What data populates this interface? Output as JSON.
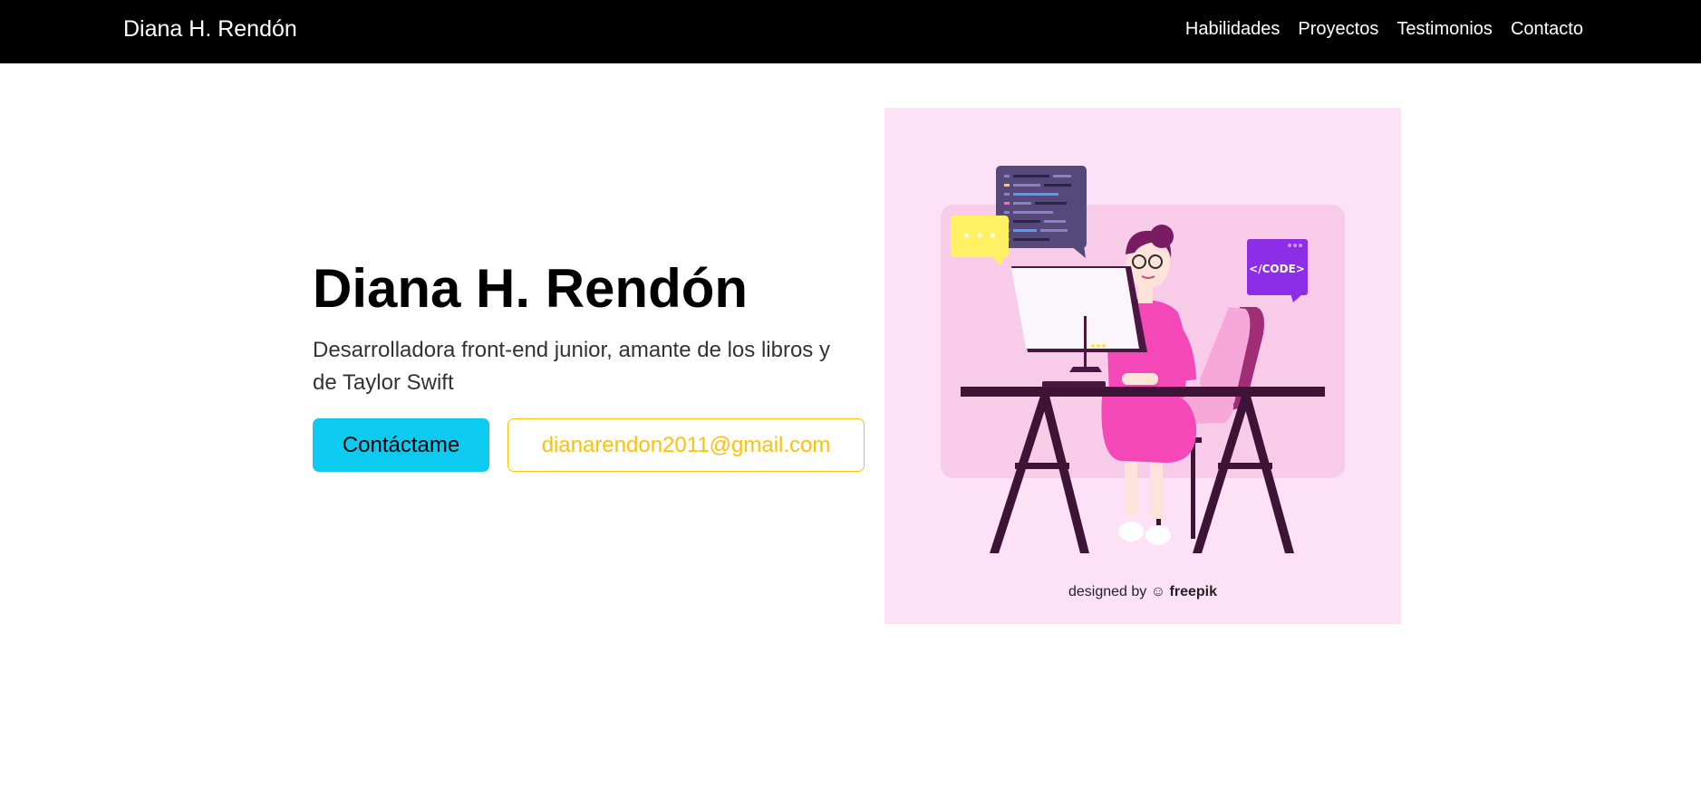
{
  "navbar": {
    "brand": "Diana H. Rendón",
    "links": [
      "Habilidades",
      "Proyectos",
      "Testimonios",
      "Contacto"
    ]
  },
  "hero": {
    "title": "Diana H. Rendón",
    "subtitle": "Desarrolladora front-end junior, amante de los libros y de Taylor Swift",
    "contact_button": "Contáctame",
    "email_button": "dianarendon2011@gmail.com"
  },
  "illustration": {
    "code_badge": "</CODE>",
    "chat_dots": "• • •",
    "credit_prefix": "designed by",
    "credit_brand": "freepik"
  },
  "colors": {
    "navbar": "#000000",
    "primary_button": "#0dcaf0",
    "email_outline": "#ffc107",
    "illustration_bg": "#fde1f6"
  },
  "icons": [
    "freepik-logo-icon",
    "code-bubble-icon",
    "chat-bubble-icon"
  ]
}
